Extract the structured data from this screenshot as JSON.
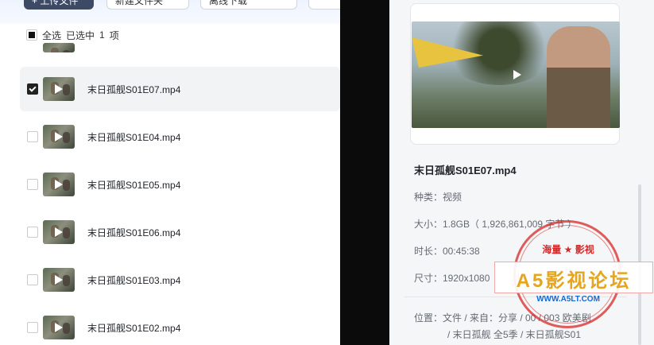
{
  "toolbar": {
    "primary_label": "+ 上传文件",
    "btn2_label": "新建文件夹",
    "btn3_label": "离线下载"
  },
  "selection": {
    "select_all_label": "全选",
    "selected_text": "已选中",
    "selected_count": "1",
    "selected_unit": "项"
  },
  "files": [
    {
      "name": "末日孤舰S01E07.mp4",
      "selected": true
    },
    {
      "name": "末日孤舰S01E04.mp4",
      "selected": false
    },
    {
      "name": "末日孤舰S01E05.mp4",
      "selected": false
    },
    {
      "name": "末日孤舰S01E06.mp4",
      "selected": false
    },
    {
      "name": "末日孤舰S01E03.mp4",
      "selected": false
    },
    {
      "name": "末日孤舰S01E02.mp4",
      "selected": false
    }
  ],
  "detail": {
    "title": "末日孤舰S01E07.mp4",
    "type_label": "种类：视频",
    "size_label": "大小：1.8GB（ 1,926,861,009 字节 ）",
    "duration_label": "时长：00:45:38",
    "resolution_label": "尺寸：1920x1080",
    "location_line1": "位置：文件 / 来自：分享 / 00 / 003 欧美剧",
    "location_line2": "/ 末日孤舰 全5季 / 末日孤舰S01"
  },
  "watermark": {
    "top": "海量 ★ 影视",
    "main": "A5影视论坛",
    "url": "WWW.A5LT.COM"
  }
}
